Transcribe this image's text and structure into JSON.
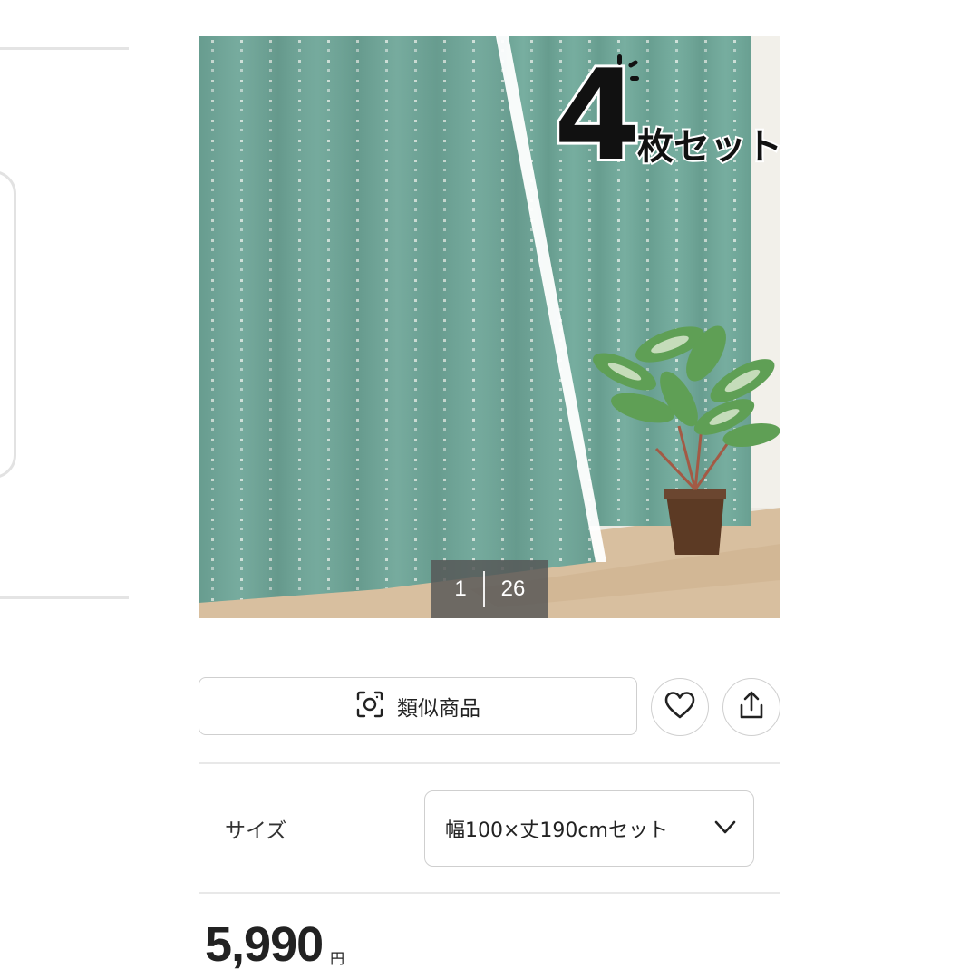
{
  "carousel": {
    "current": "1",
    "total": "26"
  },
  "product_image": {
    "badge_number": "4",
    "badge_text": "枚セット",
    "colors": {
      "curtain": "#6fa99a",
      "floor": "#d8bf9f",
      "wall": "#ece9e2"
    }
  },
  "actions": {
    "similar_label": "類似商品",
    "similar_icon": "camera-scan-icon",
    "favorite_icon": "heart-icon",
    "share_icon": "share-icon"
  },
  "size": {
    "label": "サイズ",
    "selected": "幅100×丈190cmセット",
    "chevron_icon": "chevron-down-icon"
  },
  "price": {
    "amount": "5,990",
    "currency": "円"
  }
}
